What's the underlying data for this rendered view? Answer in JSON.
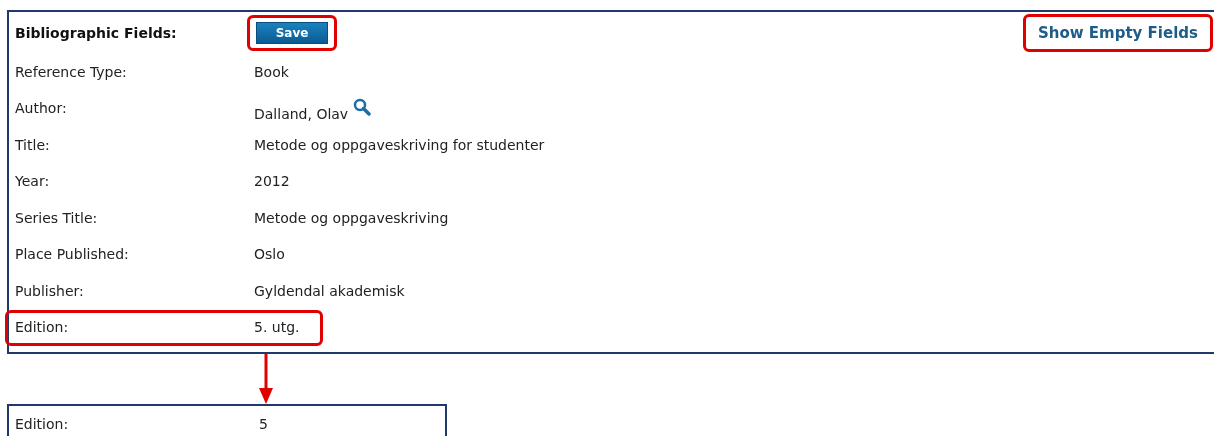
{
  "header": {
    "label": "Bibliographic Fields:",
    "save_button": {
      "label": "Save",
      "highlighted": true
    },
    "show_empty_link": {
      "label": "Show Empty Fields",
      "highlighted": true
    }
  },
  "fields": [
    {
      "label": "Reference Type:",
      "value": "Book",
      "highlighted": false
    },
    {
      "label": "Author:",
      "value": "Dalland, Olav",
      "kind": "lookup",
      "highlighted": false
    },
    {
      "label": "Title:",
      "value": "Metode og oppgaveskriving for studenter",
      "highlighted": false
    },
    {
      "label": "Year:",
      "value": "2012",
      "highlighted": false
    },
    {
      "label": "Series Title:",
      "value": "Metode og oppgaveskriving",
      "highlighted": false
    },
    {
      "label": "Place Published:",
      "value": "Oslo",
      "highlighted": false
    },
    {
      "label": "Publisher:",
      "value": "Gyldendal akademisk",
      "highlighted": false
    },
    {
      "label": "Edition:",
      "value": "5. utg.",
      "highlighted": true
    }
  ],
  "corrected_field": {
    "label": "Edition:",
    "value": "5"
  }
}
